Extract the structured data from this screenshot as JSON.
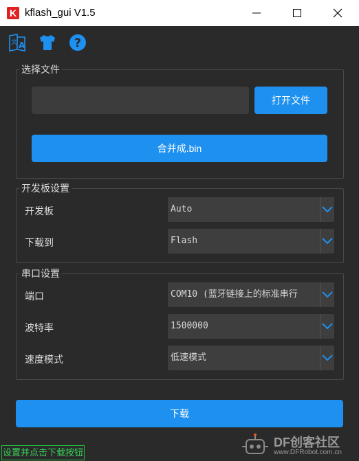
{
  "window": {
    "app_icon_letter": "K",
    "title": "kflash_gui V1.5"
  },
  "toolbar": {
    "icons": [
      "language-icon",
      "shirt-icon",
      "help-icon"
    ]
  },
  "file_group": {
    "title": "选择文件",
    "path_value": "",
    "open_button": "打开文件",
    "merge_button": "合并成.bin"
  },
  "board_group": {
    "title": "开发板设置",
    "rows": [
      {
        "label": "开发板",
        "value": "Auto"
      },
      {
        "label": "下载到",
        "value": "Flash"
      }
    ]
  },
  "serial_group": {
    "title": "串口设置",
    "rows": [
      {
        "label": "端口",
        "value": "COM10 (蓝牙链接上的标准串行"
      },
      {
        "label": "波特率",
        "value": "1500000"
      },
      {
        "label": "速度模式",
        "value": "低速模式"
      }
    ]
  },
  "download_button": "下载",
  "status_text": "设置并点击下载按钮",
  "watermark": {
    "brand": "DF创客社区",
    "url": "www.DFRobot.com.cn"
  },
  "colors": {
    "accent": "#1e90f0",
    "background": "#2a2a2a",
    "status_green": "#3ad15a"
  }
}
